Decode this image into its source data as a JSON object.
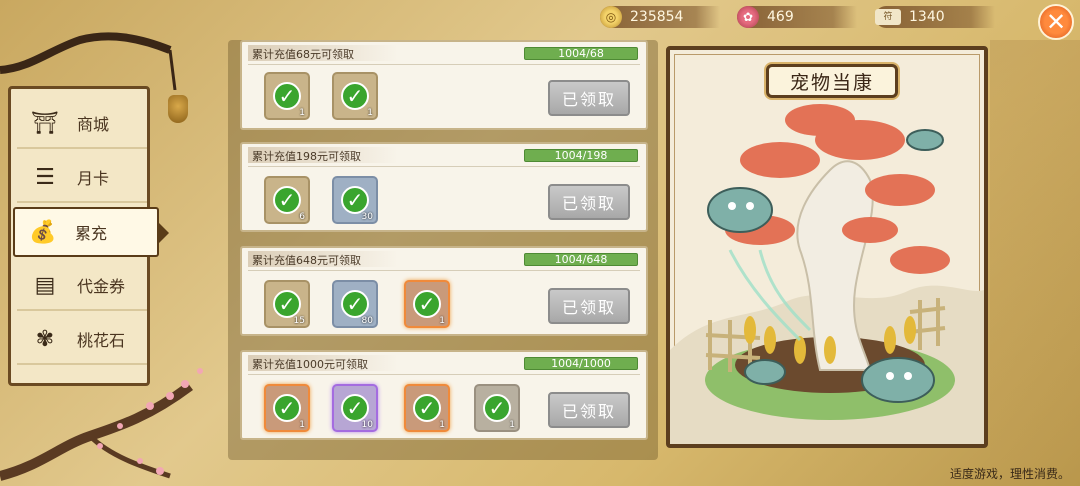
{
  "currencies": {
    "coins": "235854",
    "flowers": "469",
    "tickets": "1340",
    "ticket_icon_text": "符"
  },
  "close_label": "✕",
  "nav": {
    "items": [
      {
        "label": "商城",
        "icon": "shop-icon"
      },
      {
        "label": "月卡",
        "icon": "card-icon"
      },
      {
        "label": "累充",
        "icon": "money-bag-icon",
        "active": true
      },
      {
        "label": "代金券",
        "icon": "voucher-icon"
      },
      {
        "label": "桃花石",
        "icon": "peach-stone-icon"
      }
    ]
  },
  "rewards": [
    {
      "title": "累计充值68元可领取",
      "progress": "1004/68",
      "claim_label": "已领取",
      "items": [
        {
          "qty": "1",
          "frame": "tan"
        },
        {
          "qty": "1",
          "frame": "tan"
        }
      ]
    },
    {
      "title": "累计充值198元可领取",
      "progress": "1004/198",
      "claim_label": "已领取",
      "items": [
        {
          "qty": "6",
          "frame": "tan"
        },
        {
          "qty": "30",
          "frame": "blue"
        }
      ]
    },
    {
      "title": "累计充值648元可领取",
      "progress": "1004/648",
      "claim_label": "已领取",
      "items": [
        {
          "qty": "15",
          "frame": "tan"
        },
        {
          "qty": "80",
          "frame": "blue"
        },
        {
          "qty": "1",
          "frame": "orange"
        }
      ]
    },
    {
      "title": "累计充值1000元可领取",
      "progress": "1004/1000",
      "claim_label": "已领取",
      "items": [
        {
          "qty": "1",
          "frame": "orange"
        },
        {
          "qty": "10",
          "frame": "purple"
        },
        {
          "qty": "1",
          "frame": "orange"
        },
        {
          "qty": "1",
          "frame": "gray"
        }
      ]
    }
  ],
  "showcase": {
    "title": "宠物当康"
  },
  "footer": "适度游戏，理性消费。",
  "colors": {
    "progress_green": "#6fae4f",
    "check_green": "#3aa52e",
    "close_orange": "#ff8a3d"
  }
}
